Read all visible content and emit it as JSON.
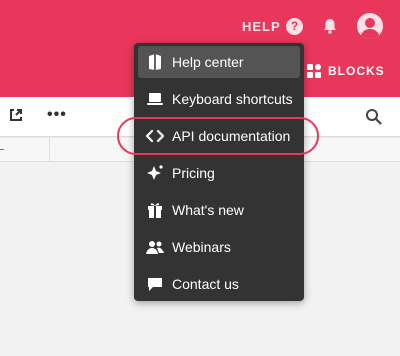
{
  "header": {
    "help_label": "HELP",
    "help_glyph": "?",
    "blocks_label": "BLOCKS",
    "bg_color": "#e8375a"
  },
  "toolbar": {
    "more_glyph": "•••"
  },
  "help_menu": {
    "items": [
      {
        "label": "Help center",
        "icon": "book-icon"
      },
      {
        "label": "Keyboard shortcuts",
        "icon": "laptop-icon"
      },
      {
        "label": "API documentation",
        "icon": "code-icon"
      },
      {
        "label": "Pricing",
        "icon": "sparkle-icon"
      },
      {
        "label": "What's new",
        "icon": "gift-icon"
      },
      {
        "label": "Webinars",
        "icon": "users-icon"
      },
      {
        "label": "Contact us",
        "icon": "chat-icon"
      }
    ],
    "hovered_item": "Help center",
    "highlighted_item": "API documentation",
    "highlight_color": "#e8375a"
  }
}
